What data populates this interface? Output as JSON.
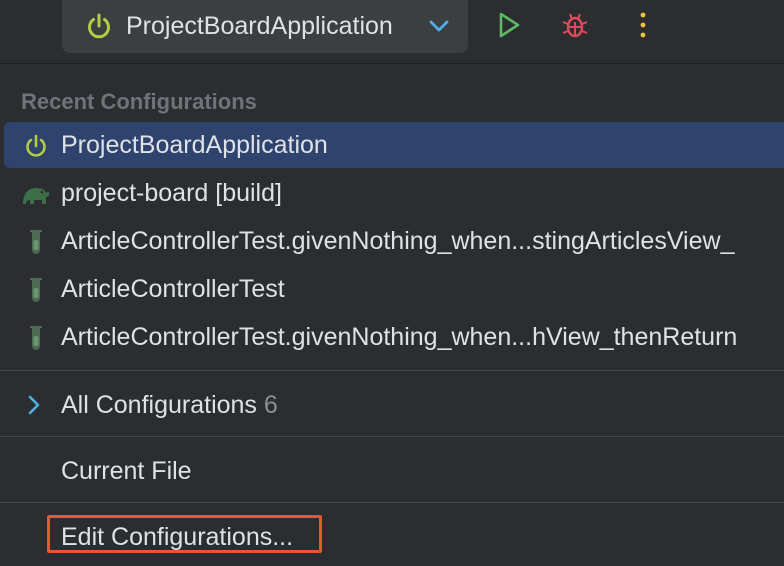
{
  "toolbar": {
    "config_name": "ProjectBoardApplication",
    "icons": {
      "power": "power-icon",
      "chevron": "chevron-down-icon",
      "run": "run-icon",
      "debug": "debug-icon",
      "more": "more-vertical-icon"
    },
    "colors": {
      "power": "#b5cc43",
      "run": "#5fb864",
      "debug": "#e5485b",
      "more": "#f0c33c",
      "chevron": "#4fb0e4"
    }
  },
  "popup": {
    "recent_header": "Recent Configurations",
    "recent_items": [
      {
        "label": "ProjectBoardApplication",
        "icon": "power-icon",
        "selected": true
      },
      {
        "label": "project-board [build]",
        "icon": "gradle-elephant-icon",
        "selected": false
      },
      {
        "label": "ArticleControllerTest.givenNothing_when...stingArticlesView_",
        "icon": "test-tube-icon",
        "selected": false
      },
      {
        "label": "ArticleControllerTest",
        "icon": "test-tube-icon",
        "selected": false
      },
      {
        "label": "ArticleControllerTest.givenNothing_when...hView_thenReturn",
        "icon": "test-tube-icon",
        "selected": false
      }
    ],
    "all_configurations": {
      "label": "All Configurations",
      "count": "6",
      "icon": "chevron-right-icon"
    },
    "current_file": "Current File",
    "edit_configurations": "Edit Configurations...",
    "colors": {
      "selected_bg": "#2e436e",
      "highlight_border": "#e8582b",
      "header_text": "#6f737a"
    }
  }
}
